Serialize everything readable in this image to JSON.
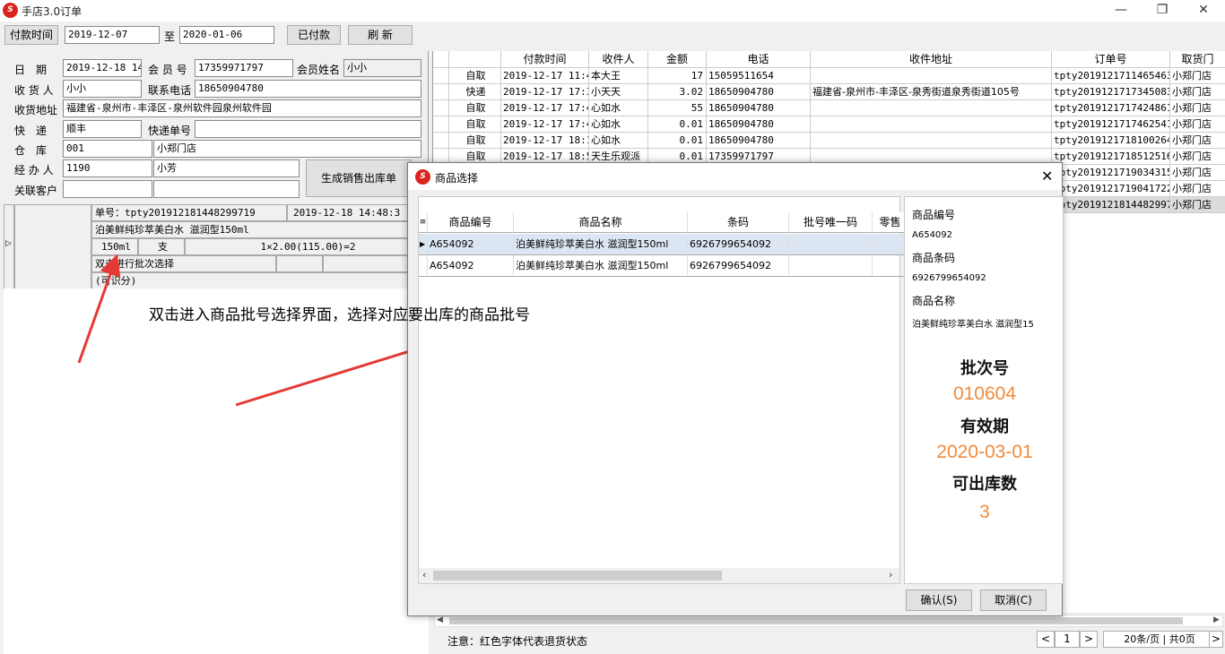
{
  "window": {
    "title": "手店3.0订单",
    "icon": "app-logo-icon",
    "minimize": "—",
    "restore": "❐",
    "close": "✕"
  },
  "toolbar": {
    "pay_time_label": "付款时间",
    "date_from": "2019-12-07",
    "to_label": "至",
    "date_to": "2020-01-06",
    "paid_button": "已付款",
    "refresh_button": "刷  新"
  },
  "order": {
    "date_label": "日　期",
    "date_value": "2019-12-18 14:",
    "member_no_label": "会 员 号",
    "member_no_value": "17359971797",
    "member_name_label": "会员姓名",
    "member_name_value": "小小",
    "receiver_label": "收 货 人",
    "receiver_value": "小小",
    "phone_label": "联系电话",
    "phone_value": "18650904780",
    "address_label": "收货地址",
    "address_value": "福建省-泉州市-丰泽区-泉州软件园泉州软件园",
    "express_label": "快　递",
    "express_value": "顺丰",
    "express_no_label": "快递单号",
    "express_no_value": "",
    "warehouse_label": "仓　库",
    "warehouse_code": "001",
    "warehouse_name": "小郑门店",
    "handler_label": "经 办 人",
    "handler_code": "1190",
    "handler_name": "小芳",
    "related_label": "关联客户",
    "related_value1": "",
    "related_value2": "",
    "generate_button": "生成销售出库单"
  },
  "detail": {
    "row_marker": "▷",
    "order_no": "单号：tpty20191218144829971​9",
    "order_time": "2019-12-18 14:48:3",
    "product_name": "泊美鲜纯珍萃美白水 滋润型150ml",
    "spec": "150ml",
    "unit": "支",
    "qty_formula": "1×2.00(115.00)=2",
    "batch_hint": "双击进行批次选择",
    "available": "(可识分)"
  },
  "annotation": {
    "text": "双击进入商品批号选择界面，选择对应要出库的商品批号",
    "color": "#e53935"
  },
  "grid": {
    "headers": [
      "付款时间",
      "收件人",
      "金额",
      "电话",
      "收件地址",
      "订单号",
      "取货门"
    ],
    "rows": [
      {
        "type": "自取",
        "time": "2019-12-17 11:4",
        "name": "本大王",
        "amount": "17",
        "phone": "15059511654",
        "addr": "",
        "order": "tpty20191217114654636",
        "store": "小郑门店"
      },
      {
        "type": "快递",
        "time": "2019-12-17 17:3",
        "name": "小天天",
        "amount": "3.02",
        "phone": "18650904780",
        "addr": "福建省-泉州市-丰泽区-泉秀街道泉秀街道105号",
        "order": "tpty20191217173450834",
        "store": "小郑门店"
      },
      {
        "type": "自取",
        "time": "2019-12-17 17:4",
        "name": "心如水",
        "amount": "55",
        "phone": "18650904780",
        "addr": "",
        "order": "tpty2019121717424861​4",
        "store": "小郑门店"
      },
      {
        "type": "自取",
        "time": "2019-12-17 17:4",
        "name": "心如水",
        "amount": "0.01",
        "phone": "18650904780",
        "addr": "",
        "order": "tpty2019121717462541​8",
        "store": "小郑门店"
      },
      {
        "type": "自取",
        "time": "2019-12-17 18:1",
        "name": "心如水",
        "amount": "0.01",
        "phone": "18650904780",
        "addr": "",
        "order": "tpty20191217181002647",
        "store": "小郑门店"
      },
      {
        "type": "自取",
        "time": "2019-12-17 18:5",
        "name": "天生乐观派",
        "amount": "0.01",
        "phone": "17359971797",
        "addr": "",
        "order": "tpty20191217185125167",
        "store": "小郑门店"
      },
      {
        "type": "",
        "time": "",
        "name": "",
        "amount": "",
        "phone": "",
        "addr": "",
        "order": "tpty2019121719034315​4",
        "store": "小郑门店"
      },
      {
        "type": "",
        "time": "",
        "name": "",
        "amount": "",
        "phone": "",
        "addr": "",
        "order": "tpty20191217190417229",
        "store": "小郑门店"
      },
      {
        "type": "",
        "time": "",
        "name": "",
        "amount": "",
        "phone": "",
        "addr": "",
        "order": "tpty20191218144829971",
        "store": "小郑门店"
      }
    ]
  },
  "footer": {
    "note": "注意：红色字体代表退货状态",
    "prev": "<",
    "page": "1",
    "next": ">",
    "per_page": "20条/页",
    "total": "共0页",
    "next_end": ">"
  },
  "dialog": {
    "title": "商品选择",
    "close": "✕",
    "headers": [
      "商品编号",
      "商品名称",
      "条码",
      "批号唯一码",
      "零售"
    ],
    "rows": [
      {
        "code": "A654092",
        "name": "泊美鲜纯珍萃美白水 滋润型150ml",
        "barcode": "6926799654092",
        "batch": "",
        "retail": ""
      },
      {
        "code": "A654092",
        "name": "泊美鲜纯珍萃美白水 滋润型150ml",
        "barcode": "6926799654092",
        "batch": "",
        "retail": ""
      }
    ],
    "info": {
      "code_label": "商品编号",
      "code_value": "A654092",
      "barcode_label": "商品条码",
      "barcode_value": "6926799654092",
      "name_label": "商品名称",
      "name_value": "泊美鲜纯珍萃美白水 滋润型15",
      "batch_label": "批次号",
      "batch_value": "010604",
      "expiry_label": "有效期",
      "expiry_value": "2020-03-01",
      "qty_label": "可出库数",
      "qty_value": "3"
    },
    "confirm_button": "确认(S)",
    "cancel_button": "取消(C)"
  }
}
